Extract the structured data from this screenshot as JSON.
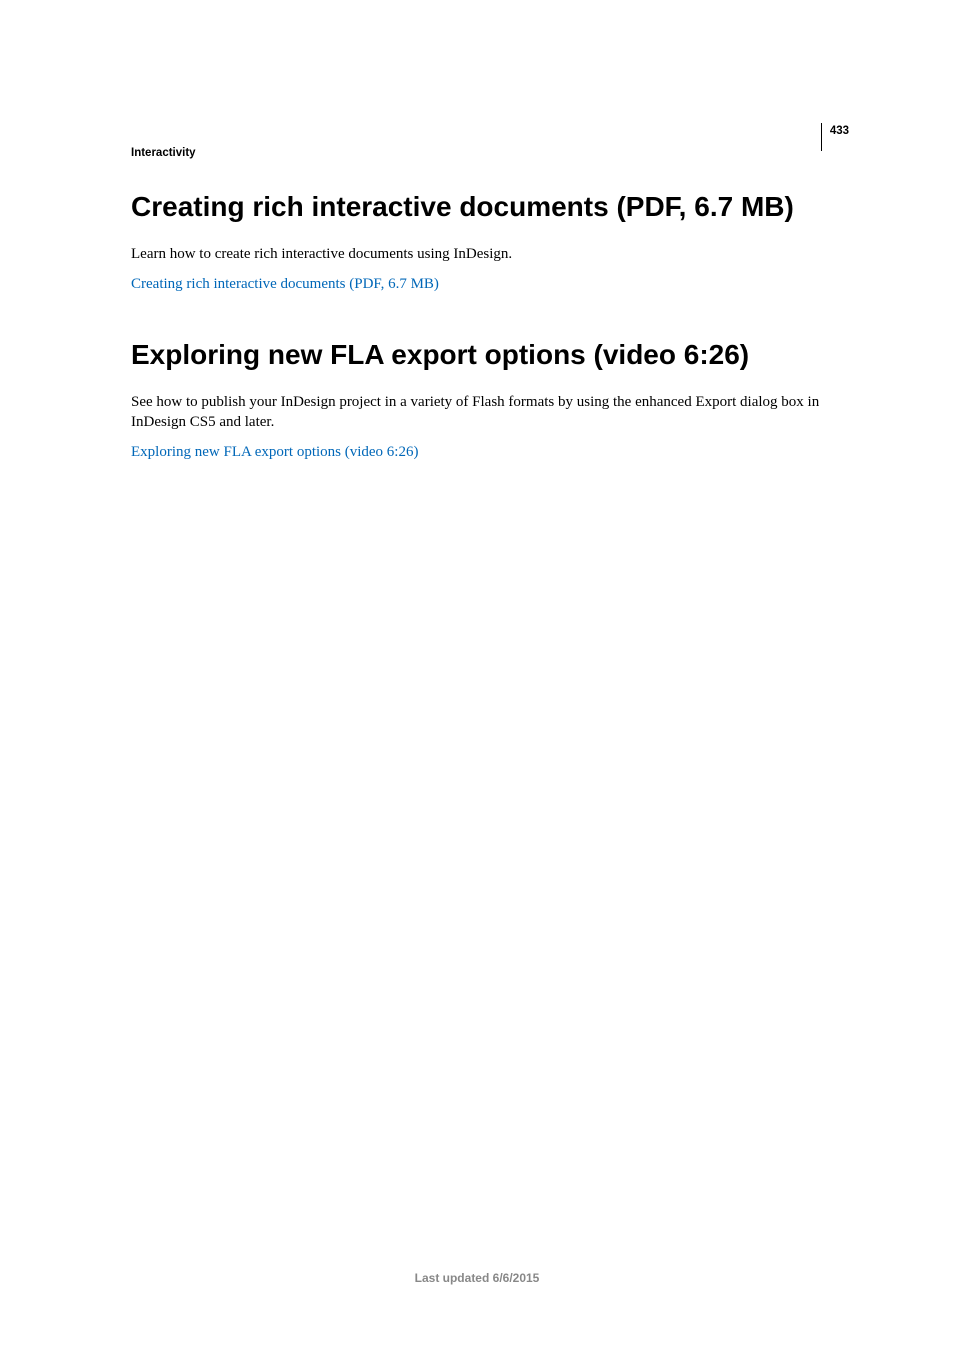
{
  "page_number": "433",
  "section_label": "Interactivity",
  "sections": [
    {
      "heading": "Creating rich interactive documents (PDF, 6.7 MB)",
      "body": "Learn how to create rich interactive documents using InDesign.",
      "link_text": "Creating rich interactive documents (PDF, 6.7 MB)"
    },
    {
      "heading": "Exploring new FLA export options (video 6:26)",
      "body": "See how to publish your InDesign project in a variety of Flash formats by using the enhanced Export dialog box in InDesign CS5 and later.",
      "link_text": "Exploring new FLA export options (video 6:26)"
    }
  ],
  "footer": "Last updated 6/6/2015"
}
